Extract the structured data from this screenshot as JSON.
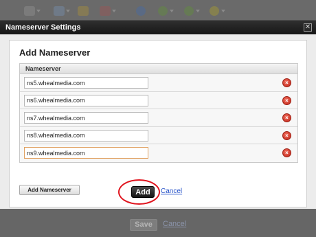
{
  "background": {
    "toolbar_icons": [
      "document-icon",
      "share-arrow-icon",
      "lock-icon",
      "calendar-icon",
      "globe-icon",
      "green-circle-icon",
      "green-circle-icon",
      "yellow-circle-icon"
    ],
    "save_label": "Save",
    "cancel_label": "Cancel"
  },
  "dialog": {
    "title": "Nameserver Settings",
    "close_glyph": "✕",
    "heading": "Add Nameserver",
    "column_header": "Nameserver",
    "nameservers": [
      {
        "value": "ns5.whealmedia.com"
      },
      {
        "value": "ns6.whealmedia.com"
      },
      {
        "value": "ns7.whealmedia.com"
      },
      {
        "value": "ns8.whealmedia.com"
      },
      {
        "value": "ns9.whealmedia.com"
      }
    ],
    "remove_glyph": "×",
    "add_nameserver_label": "Add Nameserver",
    "add_label": "Add",
    "cancel_label": "Cancel"
  },
  "colors": {
    "title_bar": "#1f1f1f",
    "remove_icon": "#d23a2b",
    "link": "#2450c8",
    "annotation": "#e0141e"
  }
}
